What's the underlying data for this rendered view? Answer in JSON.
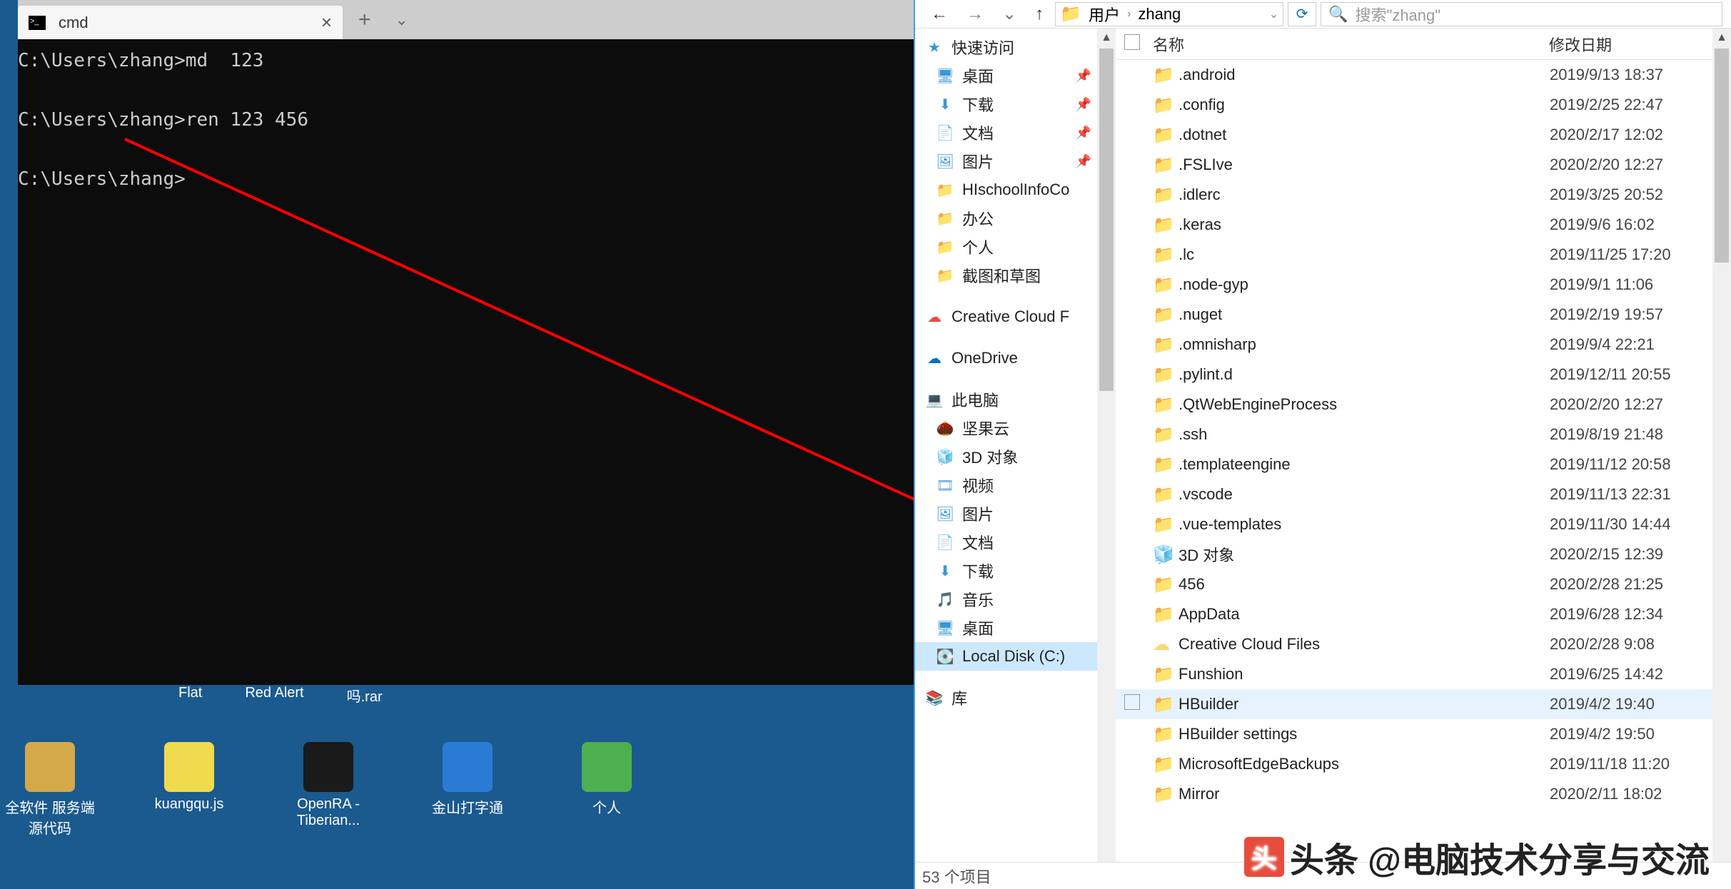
{
  "terminal": {
    "tab_title": "cmd",
    "lines": [
      "C:\\Users\\zhang>md  123",
      "",
      "C:\\Users\\zhang>ren 123 456",
      "",
      "C:\\Users\\zhang>"
    ]
  },
  "desktop": {
    "partial_labels": [
      "Flat",
      "Red Alert",
      "吗.rar"
    ],
    "icons": [
      {
        "label": "全软件 服务端源代码",
        "color": "#d4a94a"
      },
      {
        "label": "kuangqu.js",
        "color": "#f0db4f"
      },
      {
        "label": "OpenRA - Tiberian...",
        "color": "#1a1a1a"
      },
      {
        "label": "金山打字通",
        "color": "#2a7bd4"
      },
      {
        "label": "个人",
        "color": "#4daf50"
      }
    ]
  },
  "explorer": {
    "nav": {
      "back": "←",
      "fwd": "→",
      "up": "↑"
    },
    "breadcrumb": [
      "用户",
      "zhang"
    ],
    "search_placeholder": "搜索\"zhang\"",
    "columns": {
      "name": "名称",
      "date": "修改日期"
    },
    "sidebar": {
      "quick": {
        "label": "快速访问",
        "items": [
          {
            "icon": "🖥",
            "label": "桌面",
            "pin": true,
            "color": "#3b97d3"
          },
          {
            "icon": "⬇",
            "label": "下载",
            "pin": true,
            "color": "#3b97d3"
          },
          {
            "icon": "📄",
            "label": "文档",
            "pin": true,
            "color": "#6aa8d8"
          },
          {
            "icon": "🖼",
            "label": "图片",
            "pin": true,
            "color": "#3b97d3"
          },
          {
            "icon": "📁",
            "label": "HIschoolInfoCo",
            "color": "#f8d776"
          },
          {
            "icon": "📁",
            "label": "办公",
            "color": "#f8d776"
          },
          {
            "icon": "📁",
            "label": "个人",
            "color": "#f8d776"
          },
          {
            "icon": "📁",
            "label": "截图和草图",
            "color": "#f8d776"
          }
        ]
      },
      "ccloud": "Creative Cloud F",
      "onedrive": "OneDrive",
      "thispc": {
        "label": "此电脑",
        "items": [
          {
            "icon": "🌰",
            "label": "坚果云",
            "color": "#c77d2e"
          },
          {
            "icon": "🧊",
            "label": "3D 对象",
            "color": "#3b97d3"
          },
          {
            "icon": "🎞",
            "label": "视频",
            "color": "#6aa8d8"
          },
          {
            "icon": "🖼",
            "label": "图片",
            "color": "#3b97d3"
          },
          {
            "icon": "📄",
            "label": "文档",
            "color": "#6aa8d8"
          },
          {
            "icon": "⬇",
            "label": "下载",
            "color": "#3b97d3"
          },
          {
            "icon": "🎵",
            "label": "音乐",
            "color": "#3b97d3"
          },
          {
            "icon": "🖥",
            "label": "桌面",
            "color": "#3b97d3"
          },
          {
            "icon": "💽",
            "label": "Local Disk (C:)",
            "color": "#9aa0a6",
            "sel": true
          }
        ]
      },
      "libs": "库"
    },
    "files": [
      {
        "name": ".android",
        "date": "2019/9/13 18:37"
      },
      {
        "name": ".config",
        "date": "2019/2/25 22:47"
      },
      {
        "name": ".dotnet",
        "date": "2020/2/17 12:02"
      },
      {
        "name": ".FSLIve",
        "date": "2020/2/20 12:27"
      },
      {
        "name": ".idlerc",
        "date": "2019/3/25 20:52"
      },
      {
        "name": ".keras",
        "date": "2019/9/6 16:02"
      },
      {
        "name": ".lc",
        "date": "2019/11/25 17:20"
      },
      {
        "name": ".node-gyp",
        "date": "2019/9/1 11:06"
      },
      {
        "name": ".nuget",
        "date": "2019/2/19 19:57"
      },
      {
        "name": ".omnisharp",
        "date": "2019/9/4 22:21"
      },
      {
        "name": ".pylint.d",
        "date": "2019/12/11 20:55"
      },
      {
        "name": ".QtWebEngineProcess",
        "date": "2020/2/20 12:27"
      },
      {
        "name": ".ssh",
        "date": "2019/8/19 21:48"
      },
      {
        "name": ".templateengine",
        "date": "2019/11/12 20:58"
      },
      {
        "name": ".vscode",
        "date": "2019/11/13 22:31"
      },
      {
        "name": ".vue-templates",
        "date": "2019/11/30 14:44"
      },
      {
        "name": "3D 对象",
        "date": "2020/2/15 12:39",
        "icon": "🧊"
      },
      {
        "name": "456",
        "date": "2020/2/28 21:25"
      },
      {
        "name": "AppData",
        "date": "2019/6/28 12:34"
      },
      {
        "name": "Creative Cloud Files",
        "date": "2020/2/28 9:08",
        "icon": "☁"
      },
      {
        "name": "Funshion",
        "date": "2019/6/25 14:42"
      },
      {
        "name": "HBuilder",
        "date": "2019/4/2 19:40",
        "hover": true
      },
      {
        "name": "HBuilder settings",
        "date": "2019/4/2 19:50"
      },
      {
        "name": "MicrosoftEdgeBackups",
        "date": "2019/11/18 11:20"
      },
      {
        "name": "Mirror",
        "date": "2020/2/11 18:02"
      }
    ],
    "status": "53 个项目"
  },
  "watermark": "头条 @电脑技术分享与交流"
}
